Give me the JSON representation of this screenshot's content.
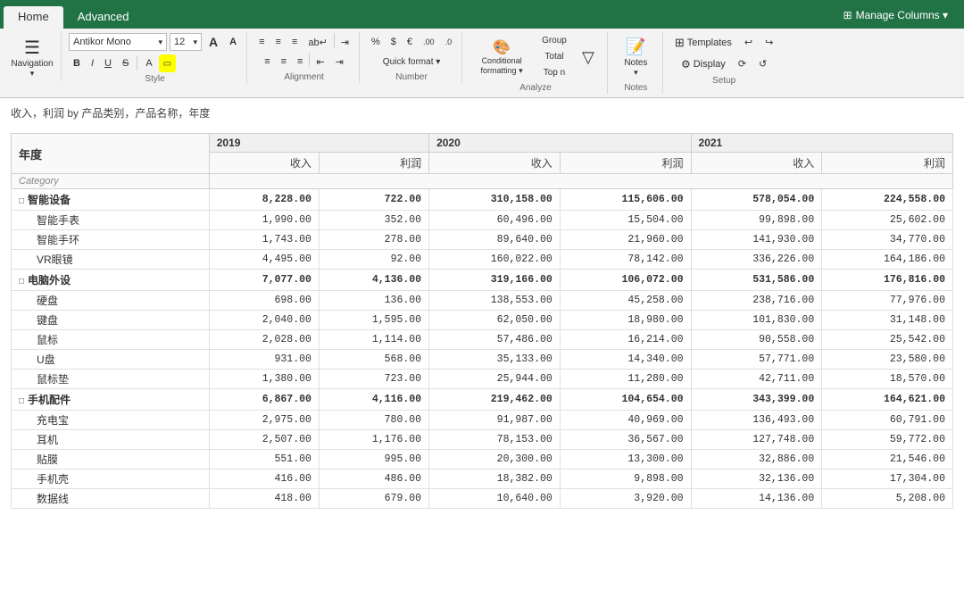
{
  "tabs": {
    "home": "Home",
    "advanced": "Advanced"
  },
  "manage_columns_btn": "Manage Columns ▾",
  "ribbon": {
    "navigation_label": "Navigation",
    "style_label": "Style",
    "alignment_label": "Alignment",
    "number_label": "Number",
    "analyze_label": "Analyze",
    "notes_label": "Notes",
    "setup_label": "Setup",
    "font_name": "Antikor Mono",
    "font_size": "12",
    "quick_format": "Quick format ▾",
    "conditional_formatting": "Conditional formatting ▾",
    "group_btn": "Group",
    "total_btn": "Total",
    "top_n_btn": "Top n",
    "notes_btn": "Notes",
    "templates_btn": "Templates",
    "display_btn": "Display"
  },
  "subtitle": "收入，利润 by 产品类别，产品名称，年度",
  "table": {
    "year_col_label": "年度",
    "category_col_label": "Category",
    "years": [
      "2019",
      "2020",
      "2021"
    ],
    "col_headers": [
      "收入",
      "利润",
      "收入",
      "利润",
      "收入",
      "利润"
    ],
    "groups": [
      {
        "name": "智能设备",
        "expanded": true,
        "values": [
          "8,228.00",
          "722.00",
          "310,158.00",
          "115,606.00",
          "578,054.00",
          "224,558.00"
        ],
        "children": [
          {
            "name": "智能手表",
            "values": [
              "1,990.00",
              "352.00",
              "60,496.00",
              "15,504.00",
              "99,898.00",
              "25,602.00"
            ]
          },
          {
            "name": "智能手环",
            "values": [
              "1,743.00",
              "278.00",
              "89,640.00",
              "21,960.00",
              "141,930.00",
              "34,770.00"
            ]
          },
          {
            "name": "VR眼镜",
            "values": [
              "4,495.00",
              "92.00",
              "160,022.00",
              "78,142.00",
              "336,226.00",
              "164,186.00"
            ]
          }
        ]
      },
      {
        "name": "电脑外设",
        "expanded": true,
        "values": [
          "7,077.00",
          "4,136.00",
          "319,166.00",
          "106,072.00",
          "531,586.00",
          "176,816.00"
        ],
        "children": [
          {
            "name": "硬盘",
            "values": [
              "698.00",
              "136.00",
              "138,553.00",
              "45,258.00",
              "238,716.00",
              "77,976.00"
            ]
          },
          {
            "name": "键盘",
            "values": [
              "2,040.00",
              "1,595.00",
              "62,050.00",
              "18,980.00",
              "101,830.00",
              "31,148.00"
            ]
          },
          {
            "name": "鼠标",
            "values": [
              "2,028.00",
              "1,114.00",
              "57,486.00",
              "16,214.00",
              "90,558.00",
              "25,542.00"
            ]
          },
          {
            "name": "U盘",
            "values": [
              "931.00",
              "568.00",
              "35,133.00",
              "14,340.00",
              "57,771.00",
              "23,580.00"
            ]
          },
          {
            "name": "鼠标垫",
            "values": [
              "1,380.00",
              "723.00",
              "25,944.00",
              "11,280.00",
              "42,711.00",
              "18,570.00"
            ]
          }
        ]
      },
      {
        "name": "手机配件",
        "expanded": true,
        "values": [
          "6,867.00",
          "4,116.00",
          "219,462.00",
          "104,654.00",
          "343,399.00",
          "164,621.00"
        ],
        "children": [
          {
            "name": "充电宝",
            "values": [
              "2,975.00",
              "780.00",
              "91,987.00",
              "40,969.00",
              "136,493.00",
              "60,791.00"
            ]
          },
          {
            "name": "耳机",
            "values": [
              "2,507.00",
              "1,176.00",
              "78,153.00",
              "36,567.00",
              "127,748.00",
              "59,772.00"
            ]
          },
          {
            "name": "贴膜",
            "values": [
              "551.00",
              "995.00",
              "20,300.00",
              "13,300.00",
              "32,886.00",
              "21,546.00"
            ]
          },
          {
            "name": "手机壳",
            "values": [
              "416.00",
              "486.00",
              "18,382.00",
              "9,898.00",
              "32,136.00",
              "17,304.00"
            ]
          },
          {
            "name": "数据线",
            "values": [
              "418.00",
              "679.00",
              "10,640.00",
              "3,920.00",
              "14,136.00",
              "5,208.00"
            ]
          }
        ]
      }
    ]
  }
}
